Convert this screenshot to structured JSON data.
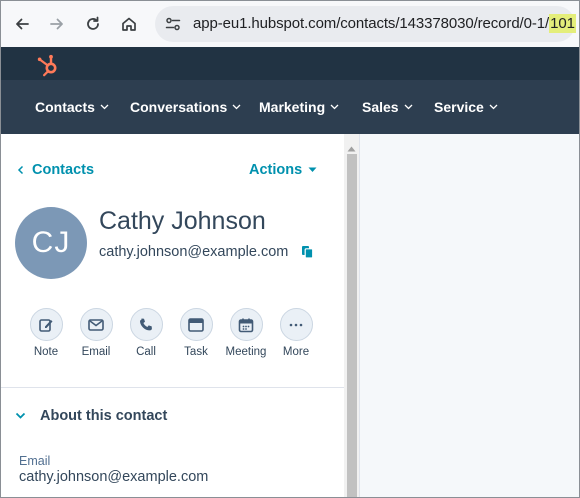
{
  "browser": {
    "url_main": "app-eu1.hubspot.com/contacts/143378030/record/0-1/",
    "url_highlight": "101"
  },
  "nav": {
    "items": [
      {
        "label": "Contacts"
      },
      {
        "label": "Conversations"
      },
      {
        "label": "Marketing"
      },
      {
        "label": "Sales"
      },
      {
        "label": "Service"
      }
    ]
  },
  "record": {
    "back_label": "Contacts",
    "actions_label": "Actions",
    "avatar_initials": "CJ",
    "name": "Cathy Johnson",
    "email": "cathy.johnson@example.com",
    "quick_actions": [
      {
        "label": "Note",
        "icon": "edit-icon"
      },
      {
        "label": "Email",
        "icon": "envelope-icon"
      },
      {
        "label": "Call",
        "icon": "phone-icon"
      },
      {
        "label": "Task",
        "icon": "task-icon"
      },
      {
        "label": "Meeting",
        "icon": "calendar-icon"
      },
      {
        "label": "More",
        "icon": "more-icon"
      }
    ]
  },
  "about": {
    "title": "About this contact",
    "fields": [
      {
        "label": "Email",
        "value": "cathy.johnson@example.com"
      }
    ]
  },
  "colors": {
    "topbar": "#213343",
    "navbar": "#2d3e50",
    "link": "#0091ae",
    "avatar": "#7c98b6",
    "logo": "#ff7a59",
    "url_highlight": "#e4ee7a"
  }
}
